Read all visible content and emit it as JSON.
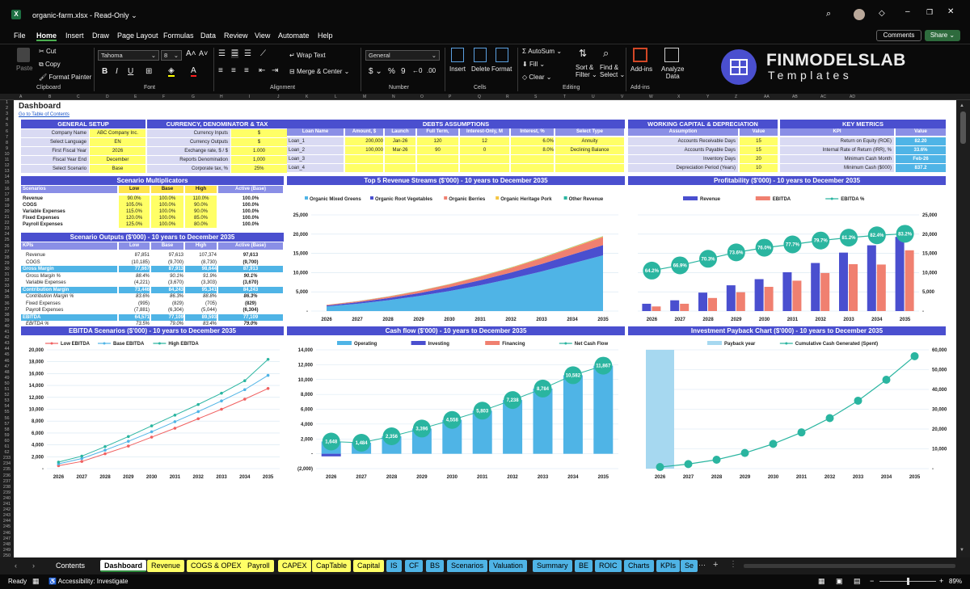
{
  "app": {
    "filename": "organic-farm.xlsx",
    "mode": "Read-Only",
    "comments": "Comments",
    "share": "Share"
  },
  "menu": [
    "File",
    "Home",
    "Insert",
    "Draw",
    "Page Layout",
    "Formulas",
    "Data",
    "Review",
    "View",
    "Automate",
    "Help"
  ],
  "ribbon": {
    "paste": "Paste",
    "cut": "Cut",
    "copy": "Copy",
    "format_painter": "Format Painter",
    "clipboard": "Clipboard",
    "font_name": "Tahoma",
    "font_size": "8",
    "font_group": "Font",
    "wrap": "Wrap Text",
    "merge": "Merge & Center",
    "alignment": "Alignment",
    "number_format": "General",
    "number": "Number",
    "insert": "Insert",
    "delete": "Delete",
    "format": "Format",
    "cells": "Cells",
    "autosum": "AutoSum",
    "fill": "Fill",
    "clear": "Clear",
    "sort": "Sort &",
    "filter": "Filter",
    "find": "Find &",
    "select": "Select",
    "editing": "Editing",
    "addins": "Add-ins",
    "addins_group": "Add-ins",
    "analyze": "Analyze",
    "analyze2": "Data",
    "brand1": "FINMODELSLAB",
    "brand2": "Templates"
  },
  "columns": [
    "A",
    "B",
    "C",
    "D",
    "E",
    "F",
    "G",
    "H",
    "I",
    "J",
    "K",
    "L",
    "M",
    "N",
    "O",
    "P",
    "Q",
    "R",
    "S",
    "T",
    "U",
    "V",
    "W",
    "X",
    "Y",
    "Z",
    "AA",
    "AB",
    "AC",
    "AD"
  ],
  "sheet": {
    "title": "Dashboard",
    "toc": "Go to Table of Contents",
    "general_setup": {
      "title": "GENERAL SETUP",
      "rows": [
        [
          "Company Name",
          "ABC Company Inc."
        ],
        [
          "Select Language",
          "EN"
        ],
        [
          "First Fiscal Year",
          "2026"
        ],
        [
          "Fiscal Year End",
          "December"
        ],
        [
          "Select Scenario",
          "Base"
        ]
      ]
    },
    "currency": {
      "title": "CURRENCY, DENOMINATOR & TAX",
      "rows": [
        [
          "Currency Inputs",
          "$"
        ],
        [
          "Currency Outputs",
          "$"
        ],
        [
          "Exchange rate, $ / $",
          "1.000"
        ],
        [
          "Reports Denomination",
          "1,000"
        ],
        [
          "Corporate tax, %",
          "25%"
        ]
      ]
    },
    "debts": {
      "title": "DEBTS ASSUMPTIONS",
      "headers": [
        "Loan Name",
        "Amount, $",
        "Launch",
        "Full Term, Months",
        "Interest-Only, M",
        "Interest, %",
        "Select Type"
      ],
      "rows": [
        [
          "Loan_1",
          "200,000",
          "Jan-26",
          "120",
          "12",
          "6.0%",
          "Annuity"
        ],
        [
          "Loan_2",
          "100,000",
          "Mar-26",
          "90",
          "0",
          "8.0%",
          "Declining Balance"
        ],
        [
          "Loan_3",
          "",
          "",
          "",
          "",
          "",
          ""
        ],
        [
          "Loan_4",
          "",
          "",
          "",
          "",
          "",
          ""
        ]
      ]
    },
    "wc": {
      "title": "WORKING CAPITAL & DEPRECIATION",
      "h1": "Assumption",
      "h2": "Value",
      "rows": [
        [
          "Accounts Receivable Days",
          "15"
        ],
        [
          "Accounts Payable Days",
          "15"
        ],
        [
          "Inventory Days",
          "20"
        ],
        [
          "Depreciation Period (Years)",
          "10"
        ]
      ]
    },
    "km": {
      "title": "KEY METRICS",
      "h1": "KPI",
      "h2": "Value",
      "rows": [
        [
          "Return on Equity (ROE)",
          "82.20"
        ],
        [
          "Internal Rate of Return (IRR), %",
          "33.6%"
        ],
        [
          "Minimum Cash Month",
          "Feb-26"
        ],
        [
          "Minimum Cash ($000)",
          "837.2"
        ]
      ]
    },
    "mult": {
      "title": "Scenario Multiplicators",
      "headers": [
        "Scenarios",
        "Low",
        "Base",
        "High",
        "Active (Base)"
      ],
      "rows": [
        [
          "Revenue",
          "90.0%",
          "100.0%",
          "110.0%",
          "100.0%"
        ],
        [
          "COGS",
          "105.0%",
          "100.0%",
          "90.0%",
          "100.0%"
        ],
        [
          "Variable Expenses",
          "115.0%",
          "100.0%",
          "90.0%",
          "100.0%"
        ],
        [
          "Fixed Expenses",
          "120.0%",
          "100.0%",
          "85.0%",
          "100.0%"
        ],
        [
          "Payroll Expenses",
          "125.0%",
          "100.0%",
          "80.0%",
          "100.0%"
        ]
      ]
    },
    "outputs": {
      "title": "Scenario Outputs ($'000) - 10 years to December 2035",
      "headers": [
        "KPIs",
        "Low",
        "Base",
        "High",
        "Active (Base)"
      ],
      "rows": [
        [
          "Revenue",
          "87,851",
          "97,613",
          "107,374",
          "97,613",
          "n"
        ],
        [
          "COGS",
          "(10,185)",
          "(9,700)",
          "(8,730)",
          "(9,700)",
          "n"
        ],
        [
          "Gross Margin",
          "77,667",
          "87,913",
          "98,644",
          "87,913",
          "b"
        ],
        [
          "Gross Margin %",
          "88.4%",
          "90.1%",
          "91.9%",
          "90.1%",
          "i"
        ],
        [
          "Variable Expenses",
          "(4,221)",
          "(3,670)",
          "(3,303)",
          "(3,670)",
          "n"
        ],
        [
          "Contribution Margin",
          "73,446",
          "84,243",
          "95,341",
          "84,243",
          "b"
        ],
        [
          "Contribution Margin %",
          "83.6%",
          "86.3%",
          "88.8%",
          "86.3%",
          "i"
        ],
        [
          "Fixed Expenses",
          "(995)",
          "(829)",
          "(705)",
          "(829)",
          "n"
        ],
        [
          "Payroll Expenses",
          "(7,881)",
          "(6,304)",
          "(5,044)",
          "(6,304)",
          "n"
        ],
        [
          "EBITDA",
          "64,571",
          "77,109",
          "89,593",
          "77,109",
          "b"
        ],
        [
          "EBITDA %",
          "73.5%",
          "79.0%",
          "83.4%",
          "79.0%",
          "i"
        ]
      ]
    }
  },
  "chart_data": [
    {
      "id": "revenue-streams",
      "type": "area",
      "title": "Top 5 Revenue Streams ($'000) - 10 years to December 2035",
      "x": [
        "2026",
        "2027",
        "2028",
        "2029",
        "2030",
        "2031",
        "2032",
        "2033",
        "2034",
        "2035"
      ],
      "ylim": [
        0,
        25000
      ],
      "yticks": [
        "-",
        "5,000",
        "10,000",
        "15,000",
        "20,000",
        "25,000"
      ],
      "series": [
        {
          "name": "Organic Mixed Greens",
          "color": "#4fb4e6",
          "values": [
            1200,
            1900,
            2800,
            3900,
            5200,
            6700,
            8400,
            10300,
            12400,
            14500
          ]
        },
        {
          "name": "Organic Root Vegetables",
          "color": "#4a4fcf",
          "values": [
            250,
            380,
            560,
            760,
            1000,
            1300,
            1600,
            1950,
            2300,
            2650
          ]
        },
        {
          "name": "Organic Berries",
          "color": "#f08070",
          "values": [
            150,
            240,
            370,
            530,
            720,
            950,
            1200,
            1480,
            1780,
            2100
          ]
        },
        {
          "name": "Organic Heritage Pork",
          "color": "#f5c542",
          "values": [
            20,
            30,
            45,
            60,
            80,
            100,
            120,
            140,
            160,
            180
          ]
        },
        {
          "name": "Other Revenue",
          "color": "#2ab5a0",
          "values": [
            10,
            15,
            20,
            25,
            30,
            35,
            40,
            45,
            50,
            55
          ]
        }
      ]
    },
    {
      "id": "profitability",
      "type": "bar",
      "title": "Profitability ($'000) - 10 years to December 2035",
      "x": [
        "2026",
        "2027",
        "2028",
        "2029",
        "2030",
        "2031",
        "2032",
        "2033",
        "2034",
        "2035"
      ],
      "ylim": [
        0,
        25000
      ],
      "yticks": [
        "-",
        "5,000",
        "10,000",
        "15,000",
        "20,000",
        "25,000"
      ],
      "series": [
        {
          "name": "Revenue",
          "color": "#4a4fcf",
          "values": [
            1900,
            2800,
            4800,
            6700,
            8300,
            10100,
            12500,
            15200,
            17100,
            19300
          ]
        },
        {
          "name": "EBITDA",
          "color": "#f08070",
          "values": [
            1200,
            1900,
            3400,
            4900,
            6300,
            7900,
            9900,
            12200,
            12100,
            15800
          ]
        },
        {
          "name": "EBITDA %",
          "color": "#2ab5a0",
          "values": [
            64.2,
            66.9,
            70.3,
            73.6,
            76.0,
            77.7,
            79.7,
            81.2,
            82.4,
            83.2
          ],
          "labels": [
            "64.2%",
            "66.9%",
            "70.3%",
            "73.6%",
            "76.0%",
            "77.7%",
            "79.7%",
            "81.2%",
            "82.4%",
            "83.2%"
          ]
        }
      ]
    },
    {
      "id": "ebitda-scenarios",
      "type": "line",
      "title": "EBITDA Scenarios ($'000) - 10 years to December 2035",
      "x": [
        "2026",
        "2027",
        "2028",
        "2029",
        "2030",
        "2031",
        "2032",
        "2033",
        "2034",
        "2035"
      ],
      "ylim": [
        0,
        20000
      ],
      "yticks": [
        "-",
        "2,000",
        "4,000",
        "6,000",
        "8,000",
        "10,000",
        "12,000",
        "14,000",
        "16,000",
        "18,000",
        "20,000"
      ],
      "series": [
        {
          "name": "Low EBITDA",
          "color": "#f06060",
          "values": [
            500,
            1200,
            2500,
            3800,
            5300,
            6800,
            8400,
            10000,
            11700,
            13500
          ]
        },
        {
          "name": "Base EBITDA",
          "color": "#4fb4e6",
          "values": [
            800,
            1700,
            3100,
            4600,
            6200,
            7900,
            9600,
            11400,
            13300,
            15700
          ]
        },
        {
          "name": "High EBITDA",
          "color": "#2ab5a0",
          "values": [
            1100,
            2100,
            3700,
            5400,
            7200,
            9000,
            10800,
            12700,
            14800,
            18400
          ]
        }
      ]
    },
    {
      "id": "cash-flow",
      "type": "bar",
      "title": "Cash flow ($'000) - 10 years to December 2035",
      "x": [
        "2026",
        "2027",
        "2028",
        "2029",
        "2030",
        "2031",
        "2032",
        "2033",
        "2034",
        "2035"
      ],
      "ylim": [
        -2000,
        14000
      ],
      "yticks": [
        "(2,000)",
        "-",
        "2,000",
        "4,000",
        "6,000",
        "8,000",
        "10,000",
        "12,000",
        "14,000"
      ],
      "series": [
        {
          "name": "Operating",
          "color": "#4fb4e6",
          "values": [
            1648,
            1484,
            2356,
            3396,
            4558,
            5803,
            7238,
            8784,
            10582,
            11867
          ]
        },
        {
          "name": "Investing",
          "color": "#4a4fcf",
          "values": [
            -350,
            0,
            0,
            0,
            0,
            0,
            0,
            0,
            0,
            0
          ]
        },
        {
          "name": "Financing",
          "color": "#f08070",
          "values": [
            0,
            0,
            0,
            0,
            0,
            0,
            0,
            0,
            0,
            0
          ]
        },
        {
          "name": "Net Cash Flow",
          "color": "#2ab5a0",
          "values": [
            1648,
            1484,
            2356,
            3396,
            4558,
            5803,
            7238,
            8784,
            10582,
            11867
          ],
          "labels": [
            "1,648",
            "1,484",
            "2,356",
            "3,396",
            "4,558",
            "5,803",
            "7,238",
            "8,784",
            "10,582",
            "11,867"
          ]
        }
      ]
    },
    {
      "id": "payback",
      "type": "line",
      "title": "Investment Payback Chart ($'000) - 10 years to December 2035",
      "x": [
        "2026",
        "2027",
        "2028",
        "2029",
        "2030",
        "2031",
        "2032",
        "2033",
        "2034",
        "2035"
      ],
      "ylim": [
        0,
        60000
      ],
      "yticks": [
        "-",
        "10,000",
        "20,000",
        "30,000",
        "40,000",
        "50,000",
        "60,000"
      ],
      "series": [
        {
          "name": "Payback year",
          "color": "#a6d8f0",
          "values": [
            1,
            0,
            0,
            0,
            0,
            0,
            0,
            0,
            0,
            0
          ]
        },
        {
          "name": "Cumulative Cash Generated (Spent)",
          "color": "#2ab5a0",
          "values": [
            800,
            2300,
            4500,
            7900,
            12500,
            18300,
            25500,
            34300,
            44900,
            56800
          ]
        }
      ]
    }
  ],
  "tabs": [
    "Contents",
    "Dashboard",
    "Revenue",
    "COGS & OPEX",
    "Payroll",
    "CAPEX",
    "CapTable",
    "Capital",
    "IS",
    "CF",
    "BS",
    "Scenarios",
    "Valuation",
    "Summary",
    "BE",
    "ROIC",
    "Charts",
    "KPIs",
    "Se"
  ],
  "status": {
    "ready": "Ready",
    "accessibility": "Accessibility: Investigate",
    "zoom": "89%"
  }
}
